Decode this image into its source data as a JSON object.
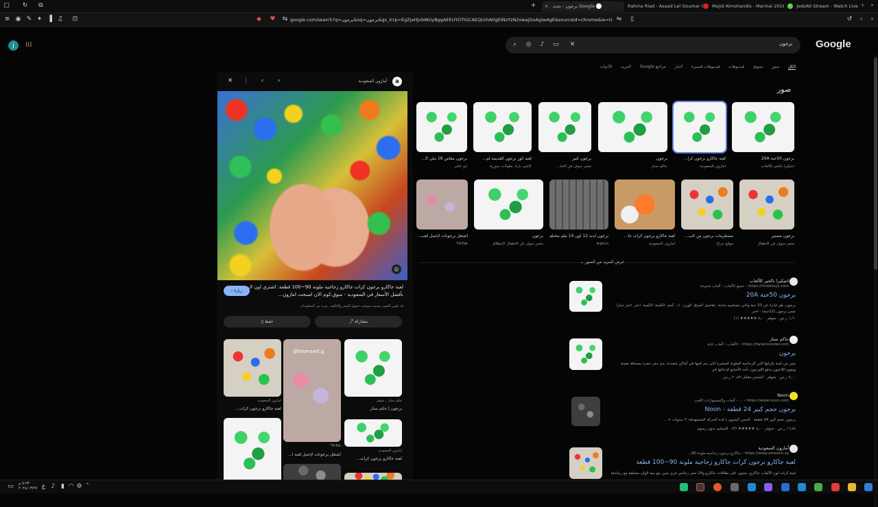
{
  "tabs": [
    {
      "label": "برجون - بحث Google",
      "active": true
    },
    {
      "label": "Rahma Riad - Asaad Lel Goumar (Of)"
    },
    {
      "label": "Majid Almohandis - Marmai 2018 |"
    },
    {
      "label": "JedoAli Stream - Watch Live on"
    }
  ],
  "toolbar": {
    "url": "google.com/search?q=برجون&oq=برجون&gs_lcrp=EgZjaHJvbWUyBggAEEUYOTIGCAEQLhhA0gEINzYzN2owajGoAgiwAgE&sourceid=chrome&ie=UT..."
  },
  "header": {
    "logo": "Google",
    "avatar_letter": "J",
    "search_query": "برجون"
  },
  "filters": [
    "الكل",
    "صور",
    "تسوق",
    "فيديوهات",
    "فيديوهات قصيرة",
    "أخبار",
    "مراجع Google",
    "المزيد",
    "الأدوات"
  ],
  "images_heading": "صور",
  "image_results": [
    {
      "caption": "برجون 50حبة 20A",
      "source": "انتيكيرا بالخير للألعاب",
      "style": "marbles-g"
    },
    {
      "caption": "لعبة جاكارو برجون كرا...",
      "source": "أمازون السعودية",
      "style": "marbles-g",
      "selected": true
    },
    {
      "caption": "برجون",
      "source": "حاكم ستار",
      "style": "marbles-g"
    },
    {
      "caption": "برجون كبير",
      "source": "متجر سوف فن الأما...",
      "style": "marbles-g"
    },
    {
      "caption": "لعبة كور برجون القديمة لم...",
      "source": "كاشي بارك بطولات سورية",
      "style": "marbles-g"
    },
    {
      "caption": "برجون مقاس 16 ملي 0...",
      "source": "أبو عامر",
      "style": "marbles-g"
    },
    {
      "caption": "برجون مستير",
      "source": "متجر سوف فن الأطفال",
      "style": "marbles-mix"
    },
    {
      "caption": "مستلزمات برجون من الب...",
      "source": "موقع حراج",
      "style": "marbles-mix"
    },
    {
      "caption": "لعبة جاكارو برجون كرات جا...",
      "source": "أمازون السعودية",
      "style": "marbles-orange"
    },
    {
      "caption": "برجون لديه 12 لون 14 ملم مختلفة...",
      "source": "lepton",
      "style": "marbles-grid"
    },
    {
      "caption": "برجون",
      "source": "متجر سوف فن الأطفال الإنطلاق",
      "style": "marbles-g"
    },
    {
      "caption": "أشتغل برجونات لإجمل لعب...",
      "source": "TikTok",
      "style": "marbles-pink"
    }
  ],
  "more_images": "عرض المزيد من الصور",
  "results": [
    {
      "site": "انتيكيرا بالخير للألعاب",
      "url": "https://moblosys.com › جميع الألعاب › ألعاب متنوعة",
      "title": "برجون 50حبة 20A",
      "snippet": "برجون. هو عبارة عن 33 حبة وتاتي بتصاميم جذابة. تفاصيل المنتج. الوزن: ٠٫١ كجم. الكمية: الكمية. اختر. اختر خيارا نفس برجون (12حبة) · اختر",
      "meta": "١٫٦٠ ر.س · متوفر · ٥٫٠ ★★★★★ (١)"
    },
    {
      "site": "حاكم ستار",
      "url": "https://hatemcenter.com › الألعاب › ألعاب غابة",
      "title": "برجون",
      "snippet": "تميز من لعبة بكراتها التي الزجاجية الملونة الصغيرة التي يتم لعبها في أماكن متعددة. يتم حفر حفرة بمسافة معينة ويقوم اللاعبون بدفع الليرجون بأحد الأصابع لإدخالها في",
      "meta": "٢٫٠٠ ر.س · متوفر · الشحن مقابل ٢٠٫٨٧ ر.س"
    },
    {
      "site": "Noon",
      "url": "https://www.noon.com › ... › ألعاب وإكسسوارات اللعب",
      "title": "برجون حجم كبير 24 قطعة - Noon",
      "snippet": "برجون حجم كبير 24 قطعة . الحس اليجيون | قدة الحركة المستهدفة: 7 سنوات + ...",
      "meta": "١٦٫٤٥ ر.س · متوفر · ٤٫٠ ★★★★★ (٣) · التسليم بدون رسوم"
    },
    {
      "site": "أمازون السعودية",
      "url": "https://www.amazon.sa › جاكارو-برجون-زجاجية-ملونة-90...",
      "title": "لعبة جاكارو برجون كرات جاكارو زجاجية ملونة 90~100 قطعة",
      "snippet": "لعبة كرات لوح الألعاب جاكارو، يحتوي على بطاقات جاكارو و24 حجر زجاجي فري متين مع بنية الوان مختلفة مع رشادها"
    }
  ],
  "panel": {
    "source": "أمازون السعودية",
    "title": "لعبة جاكارو برجون كرات جاكارو زجاجية ملونة 90~100 قطعة: اشتري اون لاين بأفضل الأسعار في السعودية - سوق.كوم الان اصبحت امازون...",
    "subtitle": "قد تكون الصور محمية بموجب حقوق النشر والتأليف. مزيد من المعلومات",
    "visit": "زيارة",
    "share": "مشاركة",
    "save": "حفظ",
    "related": [
      {
        "caption": "برجون | حكم ستار",
        "source": "حكم ستار - متوفر",
        "style": "marbles-g"
      },
      {
        "caption": "",
        "source": "TikTok",
        "style": "marbles-pink",
        "overlay": "@tosmaart.g"
      },
      {
        "caption": "لعبة جاكارو برجون كرات...",
        "source": "أمازون السعودية",
        "style": "marbles-mix"
      },
      {
        "caption": "لعبة جاكارو برجون كرات...",
        "source": "أمازون السعودية",
        "style": "marbles-g"
      },
      {
        "caption": "أشتغل برجونات لإجمل لعبة ا...",
        "source": "TikTok",
        "style": "marbles-dark"
      },
      {
        "caption": "",
        "source": "",
        "style": "marbles-mix"
      }
    ]
  },
  "taskbar": {
    "clock_time": "٥:٢٣ م",
    "clock_date": "٢٠٢٤/٠٣/٢٧"
  },
  "colors": {
    "accent": "#8ab4f8",
    "background": "#050505",
    "selected_outline": "#5d7fd8"
  }
}
